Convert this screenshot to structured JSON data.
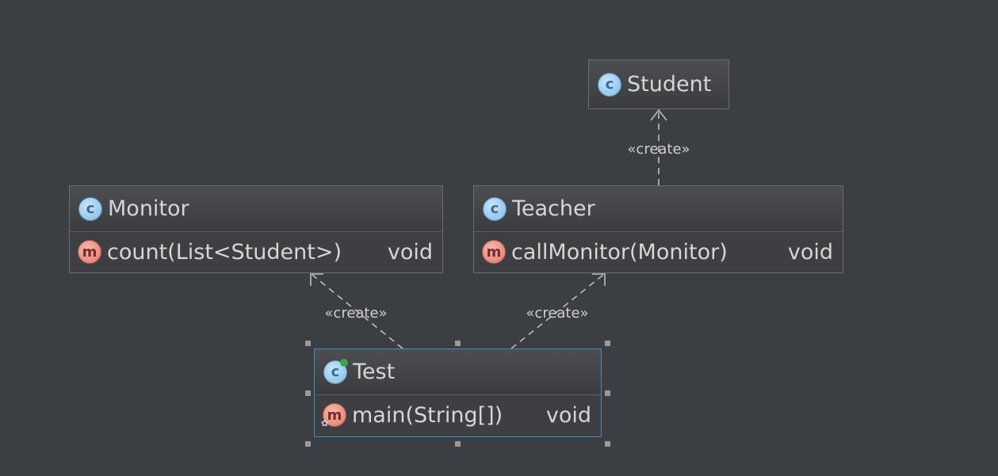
{
  "classes": {
    "student": {
      "name": "Student",
      "icon": "class-icon"
    },
    "monitor": {
      "name": "Monitor",
      "icon": "class-icon",
      "methods": [
        {
          "signature": "count(List<Student>)",
          "return_type": "void",
          "icon": "method-icon"
        }
      ]
    },
    "teacher": {
      "name": "Teacher",
      "icon": "class-icon",
      "methods": [
        {
          "signature": "callMonitor(Monitor)",
          "return_type": "void",
          "icon": "method-icon"
        }
      ]
    },
    "test": {
      "name": "Test",
      "icon": "runnable-class-icon",
      "selected": true,
      "methods": [
        {
          "signature": "main(String[])",
          "return_type": "void",
          "icon": "static-method-icon"
        }
      ]
    }
  },
  "relations": [
    {
      "from": "Teacher",
      "to": "Student",
      "label": "«create»"
    },
    {
      "from": "Test",
      "to": "Monitor",
      "label": "«create»"
    },
    {
      "from": "Test",
      "to": "Teacher",
      "label": "«create»"
    }
  ],
  "icon_glyphs": {
    "class": "c",
    "method": "m"
  },
  "colors": {
    "background": "#3b3e42",
    "selection": "#4a88c7",
    "edge": "#bdbdbd"
  }
}
